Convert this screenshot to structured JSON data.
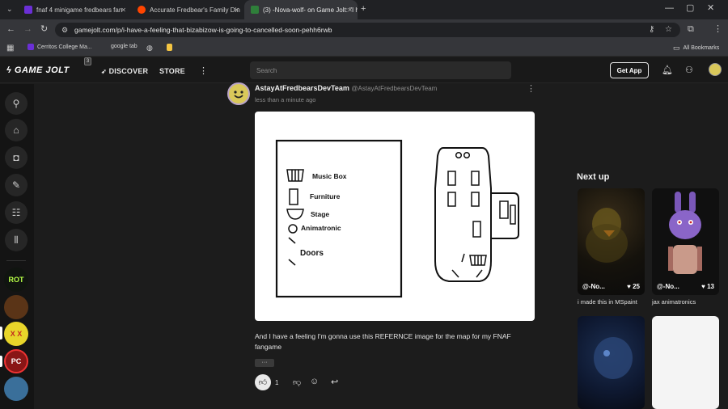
{
  "browser": {
    "tabs": [
      {
        "title": "fnaf 4 minigame fredbears fan",
        "favicon_color": "#6b2fd6"
      },
      {
        "title": "Accurate Fredbear's Family Din",
        "favicon_color": "#ff4500"
      },
      {
        "title": "(3) -Nova-wolf- on Game Jolt: \"I h",
        "favicon_color": "#2f7f3a"
      }
    ],
    "url": "gamejolt.com/p/i-have-a-feeling-that-bizabizow-is-going-to-cancelled-soon-pehh6rwb",
    "bookmarks": [
      {
        "label": "Cerritos College Ma..."
      },
      {
        "label": "google tab"
      }
    ],
    "all_bookmarks_label": "All Bookmarks"
  },
  "header": {
    "logo_text": "GAME JOLT",
    "badge": "3",
    "nav": [
      {
        "label": "DISCOVER"
      },
      {
        "label": "STORE"
      }
    ],
    "search_placeholder": "Search",
    "get_app_label": "Get App"
  },
  "rail": {
    "avatars": [
      {
        "label": "ROT",
        "bg": "#101410",
        "fg": "#b7ff47"
      },
      {
        "label": "",
        "bg": "#5a3417",
        "fg": "#ffb34a"
      },
      {
        "label": "X X",
        "bg": "#e8d52a",
        "fg": "#c22a1f"
      },
      {
        "label": "PC",
        "bg": "#8a1616",
        "fg": "#ffffff"
      },
      {
        "label": "",
        "bg": "#3a6f9a",
        "fg": "#ffffff"
      }
    ]
  },
  "post": {
    "author": "AstayAtFredbearsDevTeam",
    "handle": "@AstayAtFredbearsDevTeam",
    "time": "less than a minute ago",
    "body": "And I have a feeling I'm gonna use this REFERNCE image for the map for my FNAF fangame",
    "more_label": "···",
    "likes": "1",
    "image": {
      "legend": [
        {
          "label": "Music Box"
        },
        {
          "label": "Furniture"
        },
        {
          "label": "Stage"
        },
        {
          "label": "Animatronic"
        },
        {
          "label": "Doors"
        }
      ]
    }
  },
  "next_up": {
    "title": "Next up",
    "cards": [
      {
        "author": "@-No...",
        "likes": "25",
        "title": "i made this in MSpaint"
      },
      {
        "author": "@-No...",
        "likes": "13",
        "title": "jax animatronics"
      }
    ]
  },
  "colors": {
    "accent": "#ccff00",
    "bg": "#1c1c1c",
    "header": "#191919"
  }
}
